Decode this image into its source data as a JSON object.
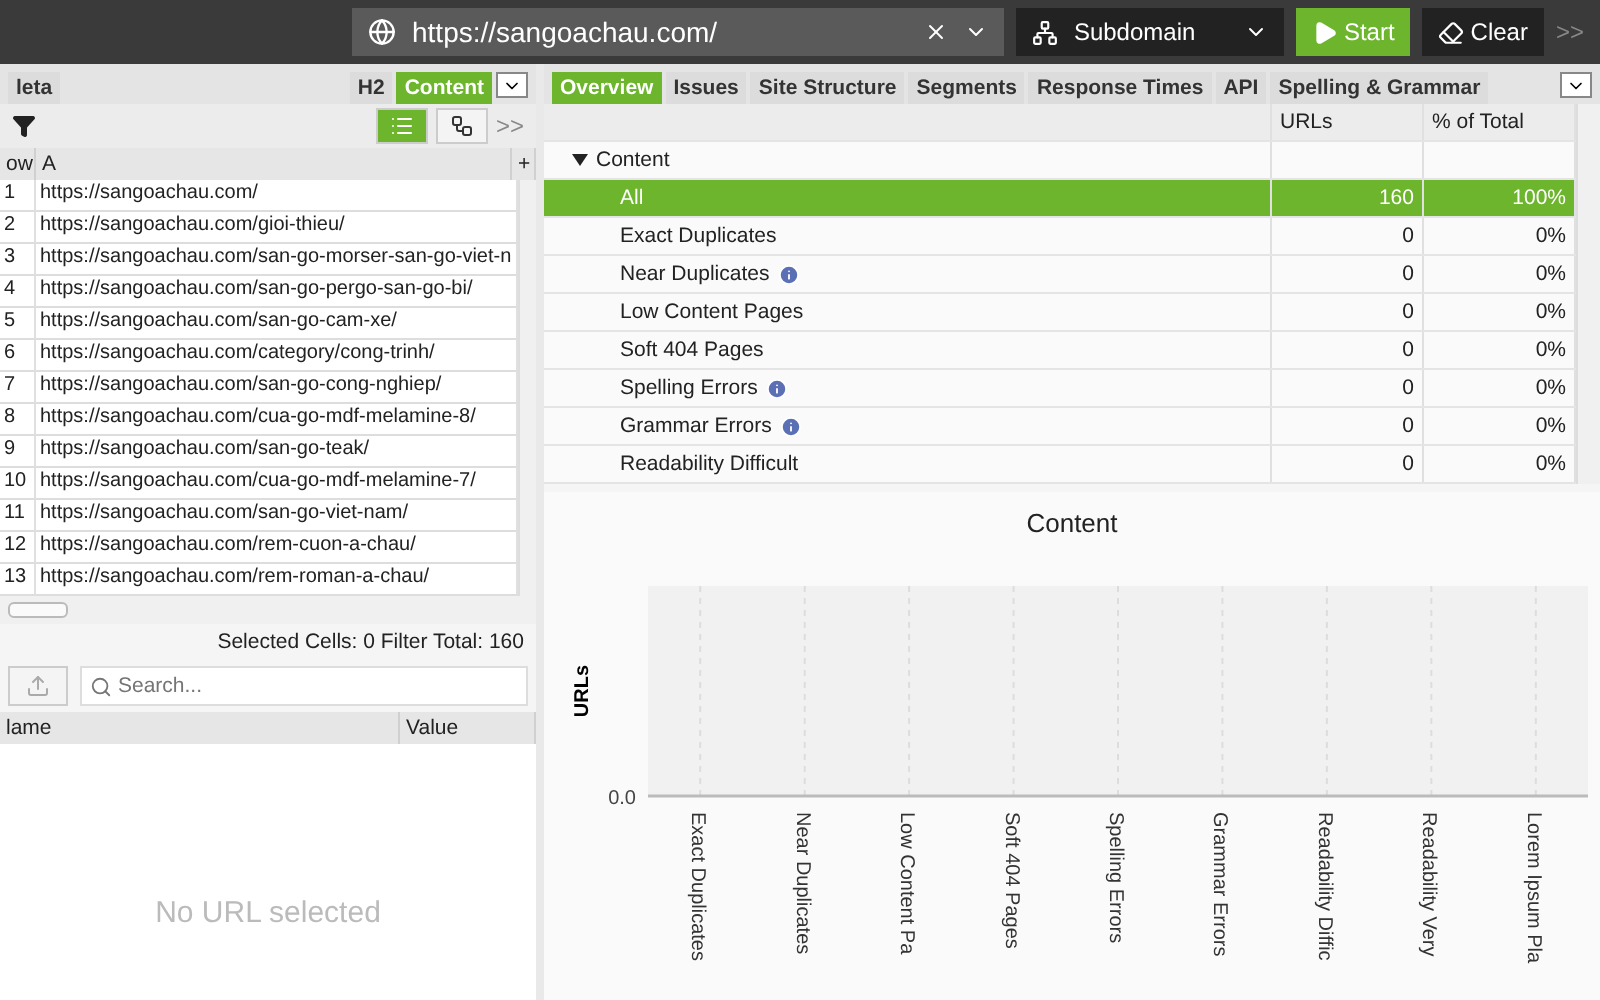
{
  "toolbar": {
    "url": "https://sangoachau.com/",
    "mode": "Subdomain",
    "start": "Start",
    "clear": "Clear",
    "more": ">>"
  },
  "left_tabs": [
    {
      "label": "leta",
      "selected": false
    },
    {
      "label": "H2",
      "selected": false
    },
    {
      "label": "Content",
      "selected": true
    }
  ],
  "left_view": {
    "views": [
      {
        "kind": "list",
        "selected": true
      },
      {
        "kind": "tree",
        "selected": false
      }
    ],
    "more": ">>"
  },
  "url_table": {
    "columns": [
      "ow",
      "A",
      "+"
    ],
    "rows": [
      [
        "1",
        "https://sangoachau.com/"
      ],
      [
        "2",
        "https://sangoachau.com/gioi-thieu/"
      ],
      [
        "3",
        "https://sangoachau.com/san-go-morser-san-go-viet-n"
      ],
      [
        "4",
        "https://sangoachau.com/san-go-pergo-san-go-bi/"
      ],
      [
        "5",
        "https://sangoachau.com/san-go-cam-xe/"
      ],
      [
        "6",
        "https://sangoachau.com/category/cong-trinh/"
      ],
      [
        "7",
        "https://sangoachau.com/san-go-cong-nghiep/"
      ],
      [
        "8",
        "https://sangoachau.com/cua-go-mdf-melamine-8/"
      ],
      [
        "9",
        "https://sangoachau.com/san-go-teak/"
      ],
      [
        "10",
        "https://sangoachau.com/cua-go-mdf-melamine-7/"
      ],
      [
        "11",
        "https://sangoachau.com/san-go-viet-nam/"
      ],
      [
        "12",
        "https://sangoachau.com/rem-cuon-a-chau/"
      ],
      [
        "13",
        "https://sangoachau.com/rem-roman-a-chau/"
      ]
    ],
    "status": "Selected Cells: 0  Filter Total: 160"
  },
  "details": {
    "search_placeholder": "Search...",
    "columns": [
      "lame",
      "Value"
    ],
    "empty": "No URL selected"
  },
  "right_tabs": [
    {
      "label": "Overview",
      "selected": true
    },
    {
      "label": "Issues",
      "selected": false
    },
    {
      "label": "Site Structure",
      "selected": false
    },
    {
      "label": "Segments",
      "selected": false
    },
    {
      "label": "Response Times",
      "selected": false
    },
    {
      "label": "API",
      "selected": false
    },
    {
      "label": "Spelling & Grammar",
      "selected": false
    }
  ],
  "overview": {
    "columns": [
      "URLs",
      "% of Total"
    ],
    "rows": [
      {
        "kind": "group",
        "label": "Content",
        "expanded": true
      },
      {
        "kind": "item",
        "label": "All",
        "urls": "160",
        "percent": "100%",
        "selected": true,
        "info": false
      },
      {
        "kind": "item",
        "label": "Exact Duplicates",
        "urls": "0",
        "percent": "0%",
        "selected": false,
        "info": false
      },
      {
        "kind": "item",
        "label": "Near Duplicates",
        "urls": "0",
        "percent": "0%",
        "selected": false,
        "info": true
      },
      {
        "kind": "item",
        "label": "Low Content Pages",
        "urls": "0",
        "percent": "0%",
        "selected": false,
        "info": false
      },
      {
        "kind": "item",
        "label": "Soft 404 Pages",
        "urls": "0",
        "percent": "0%",
        "selected": false,
        "info": false
      },
      {
        "kind": "item",
        "label": "Spelling Errors",
        "urls": "0",
        "percent": "0%",
        "selected": false,
        "info": true
      },
      {
        "kind": "item",
        "label": "Grammar Errors",
        "urls": "0",
        "percent": "0%",
        "selected": false,
        "info": true
      },
      {
        "kind": "item",
        "label": "Readability Difficult",
        "urls": "0",
        "percent": "0%",
        "selected": false,
        "info": false
      }
    ]
  },
  "chart": {
    "title": "Content",
    "ylabel": "URLs",
    "ytick": "0.0",
    "categories": [
      "Exact Duplicates",
      "Near Duplicates",
      "Low Content Pa",
      "Soft 404 Pages",
      "Spelling Errors",
      "Grammar Errors",
      "Readability Diffic",
      "Readability Very",
      "Lorem Ipsum Pla"
    ]
  }
}
